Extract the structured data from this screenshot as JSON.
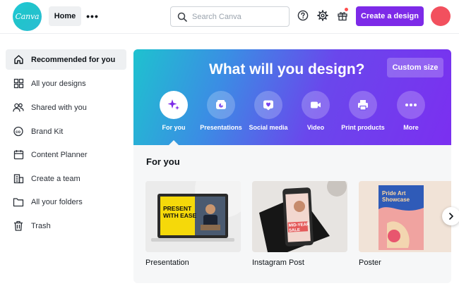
{
  "app": {
    "logo_text": "Canva"
  },
  "topbar": {
    "home_label": "Home",
    "more_label": "•••",
    "search": {
      "placeholder": "Search Canva",
      "value": ""
    },
    "create_button": "Create a design",
    "icons": [
      "help-icon",
      "settings-icon",
      "gift-icon"
    ]
  },
  "sidebar": {
    "items": [
      {
        "label": "Recommended for you",
        "icon": "home-icon",
        "active": true
      },
      {
        "label": "All your designs",
        "icon": "grid-icon"
      },
      {
        "label": "Shared with you",
        "icon": "people-icon"
      },
      {
        "label": "Brand Kit",
        "icon": "brand-kit-icon"
      },
      {
        "label": "Content Planner",
        "icon": "calendar-icon"
      },
      {
        "label": "Create a team",
        "icon": "team-icon"
      },
      {
        "label": "All your folders",
        "icon": "folder-icon"
      },
      {
        "label": "Trash",
        "icon": "trash-icon"
      }
    ]
  },
  "hero": {
    "title": "What will you design?",
    "custom_size": "Custom size",
    "categories": [
      {
        "label": "For you",
        "icon": "sparkle-icon",
        "active": true
      },
      {
        "label": "Presentations",
        "icon": "presentation-icon"
      },
      {
        "label": "Social media",
        "icon": "heart-icon"
      },
      {
        "label": "Video",
        "icon": "video-icon"
      },
      {
        "label": "Print products",
        "icon": "printer-icon"
      },
      {
        "label": "More",
        "icon": "more-icon"
      }
    ]
  },
  "for_you": {
    "title": "For you",
    "cards": [
      {
        "label": "Presentation",
        "thumb_text": "PRESENT WITH EASE"
      },
      {
        "label": "Instagram Post",
        "thumb_text": "MID-YEAR SALE"
      },
      {
        "label": "Poster",
        "thumb_text": "Pride Art Showcase"
      }
    ]
  },
  "colors": {
    "accent": "#7d2ae8",
    "logo": "#20c4cb",
    "avatar": "#f2505e"
  }
}
